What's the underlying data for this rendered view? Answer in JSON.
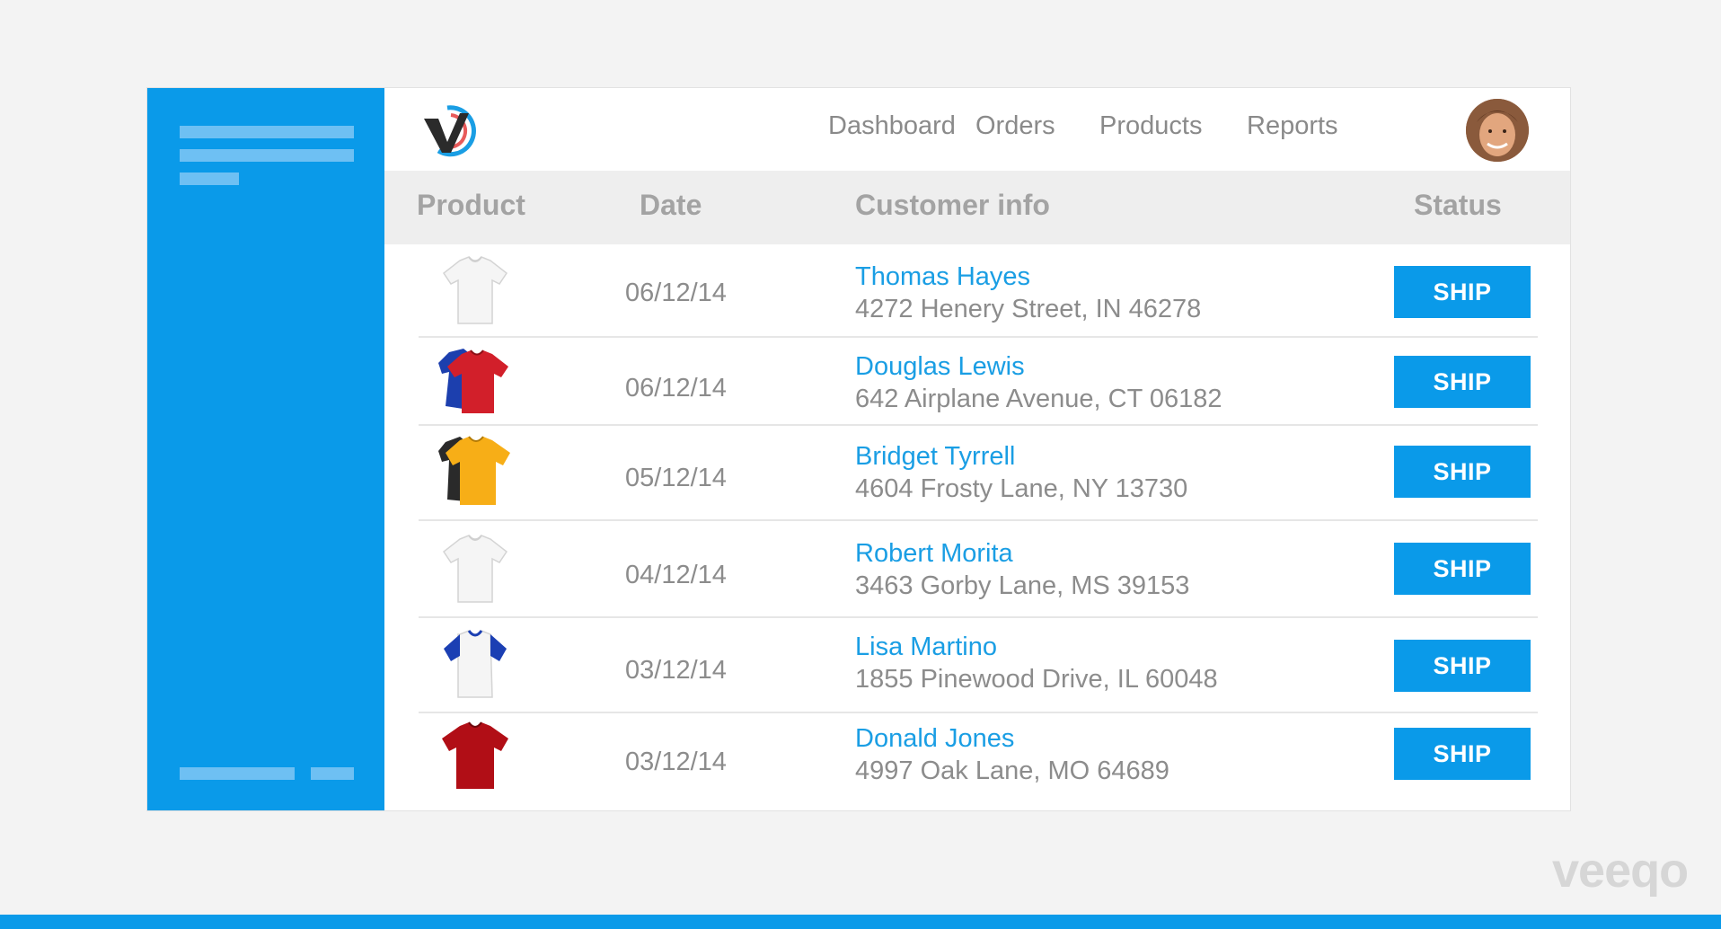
{
  "nav": {
    "items": [
      {
        "label": "Dashboard"
      },
      {
        "label": "Orders"
      },
      {
        "label": "Products"
      },
      {
        "label": "Reports"
      }
    ]
  },
  "table": {
    "headers": {
      "product": "Product",
      "date": "Date",
      "customer": "Customer info",
      "status": "Status"
    },
    "rows": [
      {
        "product_icon": "white-tshirt-icon",
        "date": "06/12/14",
        "name": "Thomas Hayes",
        "address": "4272 Henery Street, IN 46278",
        "action": "SHIP"
      },
      {
        "product_icon": "red-blue-tshirt-icon",
        "date": "06/12/14",
        "name": "Douglas Lewis",
        "address": "642 Airplane Avenue, CT 06182",
        "action": "SHIP"
      },
      {
        "product_icon": "yellow-black-tshirt-icon",
        "date": "05/12/14",
        "name": "Bridget Tyrrell",
        "address": "4604 Frosty Lane, NY 13730",
        "action": "SHIP"
      },
      {
        "product_icon": "white-tshirt-icon",
        "date": "04/12/14",
        "name": "Robert Morita",
        "address": "3463 Gorby Lane, MS 39153",
        "action": "SHIP"
      },
      {
        "product_icon": "white-blue-raglan-tshirt-icon",
        "date": "03/12/14",
        "name": "Lisa Martino",
        "address": "1855 Pinewood Drive, IL 60048",
        "action": "SHIP"
      },
      {
        "product_icon": "red-tshirt-icon",
        "date": "03/12/14",
        "name": "Donald Jones",
        "address": "4997 Oak Lane, MO 64689",
        "action": "SHIP"
      }
    ]
  },
  "watermark": {
    "text": "veeqo"
  },
  "colors": {
    "brand_blue": "#0a9ae9",
    "link_blue": "#1a9ee4",
    "header_bg": "#eeeeee"
  }
}
